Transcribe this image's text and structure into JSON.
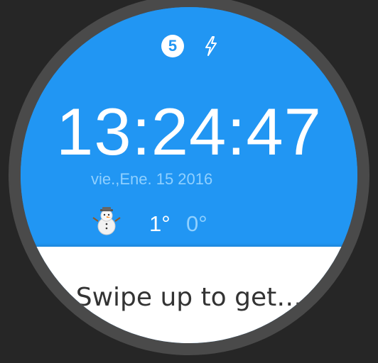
{
  "status_bar": {
    "notification_count": "5",
    "icons": [
      "notification-count-badge",
      "bolt-icon"
    ]
  },
  "watchface": {
    "time": "13:24:47",
    "date": "vie.,Ene. 15 2016",
    "weather": {
      "icon": "snowman-icon",
      "temp_high": "1°",
      "temp_low": "0°"
    }
  },
  "card": {
    "text": "Swipe up to get…"
  },
  "colors": {
    "face_blue": "#2196f3",
    "date_light_blue": "#8fd0ff",
    "bezel": "#4a4a4a",
    "background": "#262626",
    "card_white": "#ffffff"
  }
}
